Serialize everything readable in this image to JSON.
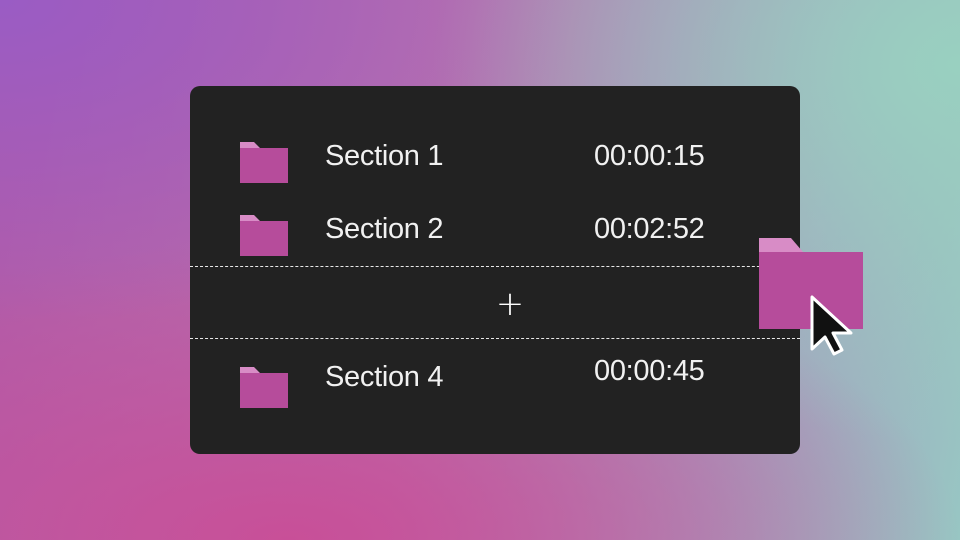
{
  "colors": {
    "panel": "#222222",
    "folder_body": "#b64c9b",
    "folder_tab": "#d88cc6",
    "text": "#f1f1f1"
  },
  "icons": {
    "folder": "folder-icon",
    "plus": "plus-icon",
    "cursor": "mouse-pointer-icon"
  },
  "sections": [
    {
      "name": "Section 1",
      "duration": "00:00:15"
    },
    {
      "name": "Section 2",
      "duration": "00:02:52"
    },
    {
      "name": "Section 4",
      "duration": "00:00:45"
    }
  ],
  "drop_zone": {
    "plus_label": "+"
  }
}
